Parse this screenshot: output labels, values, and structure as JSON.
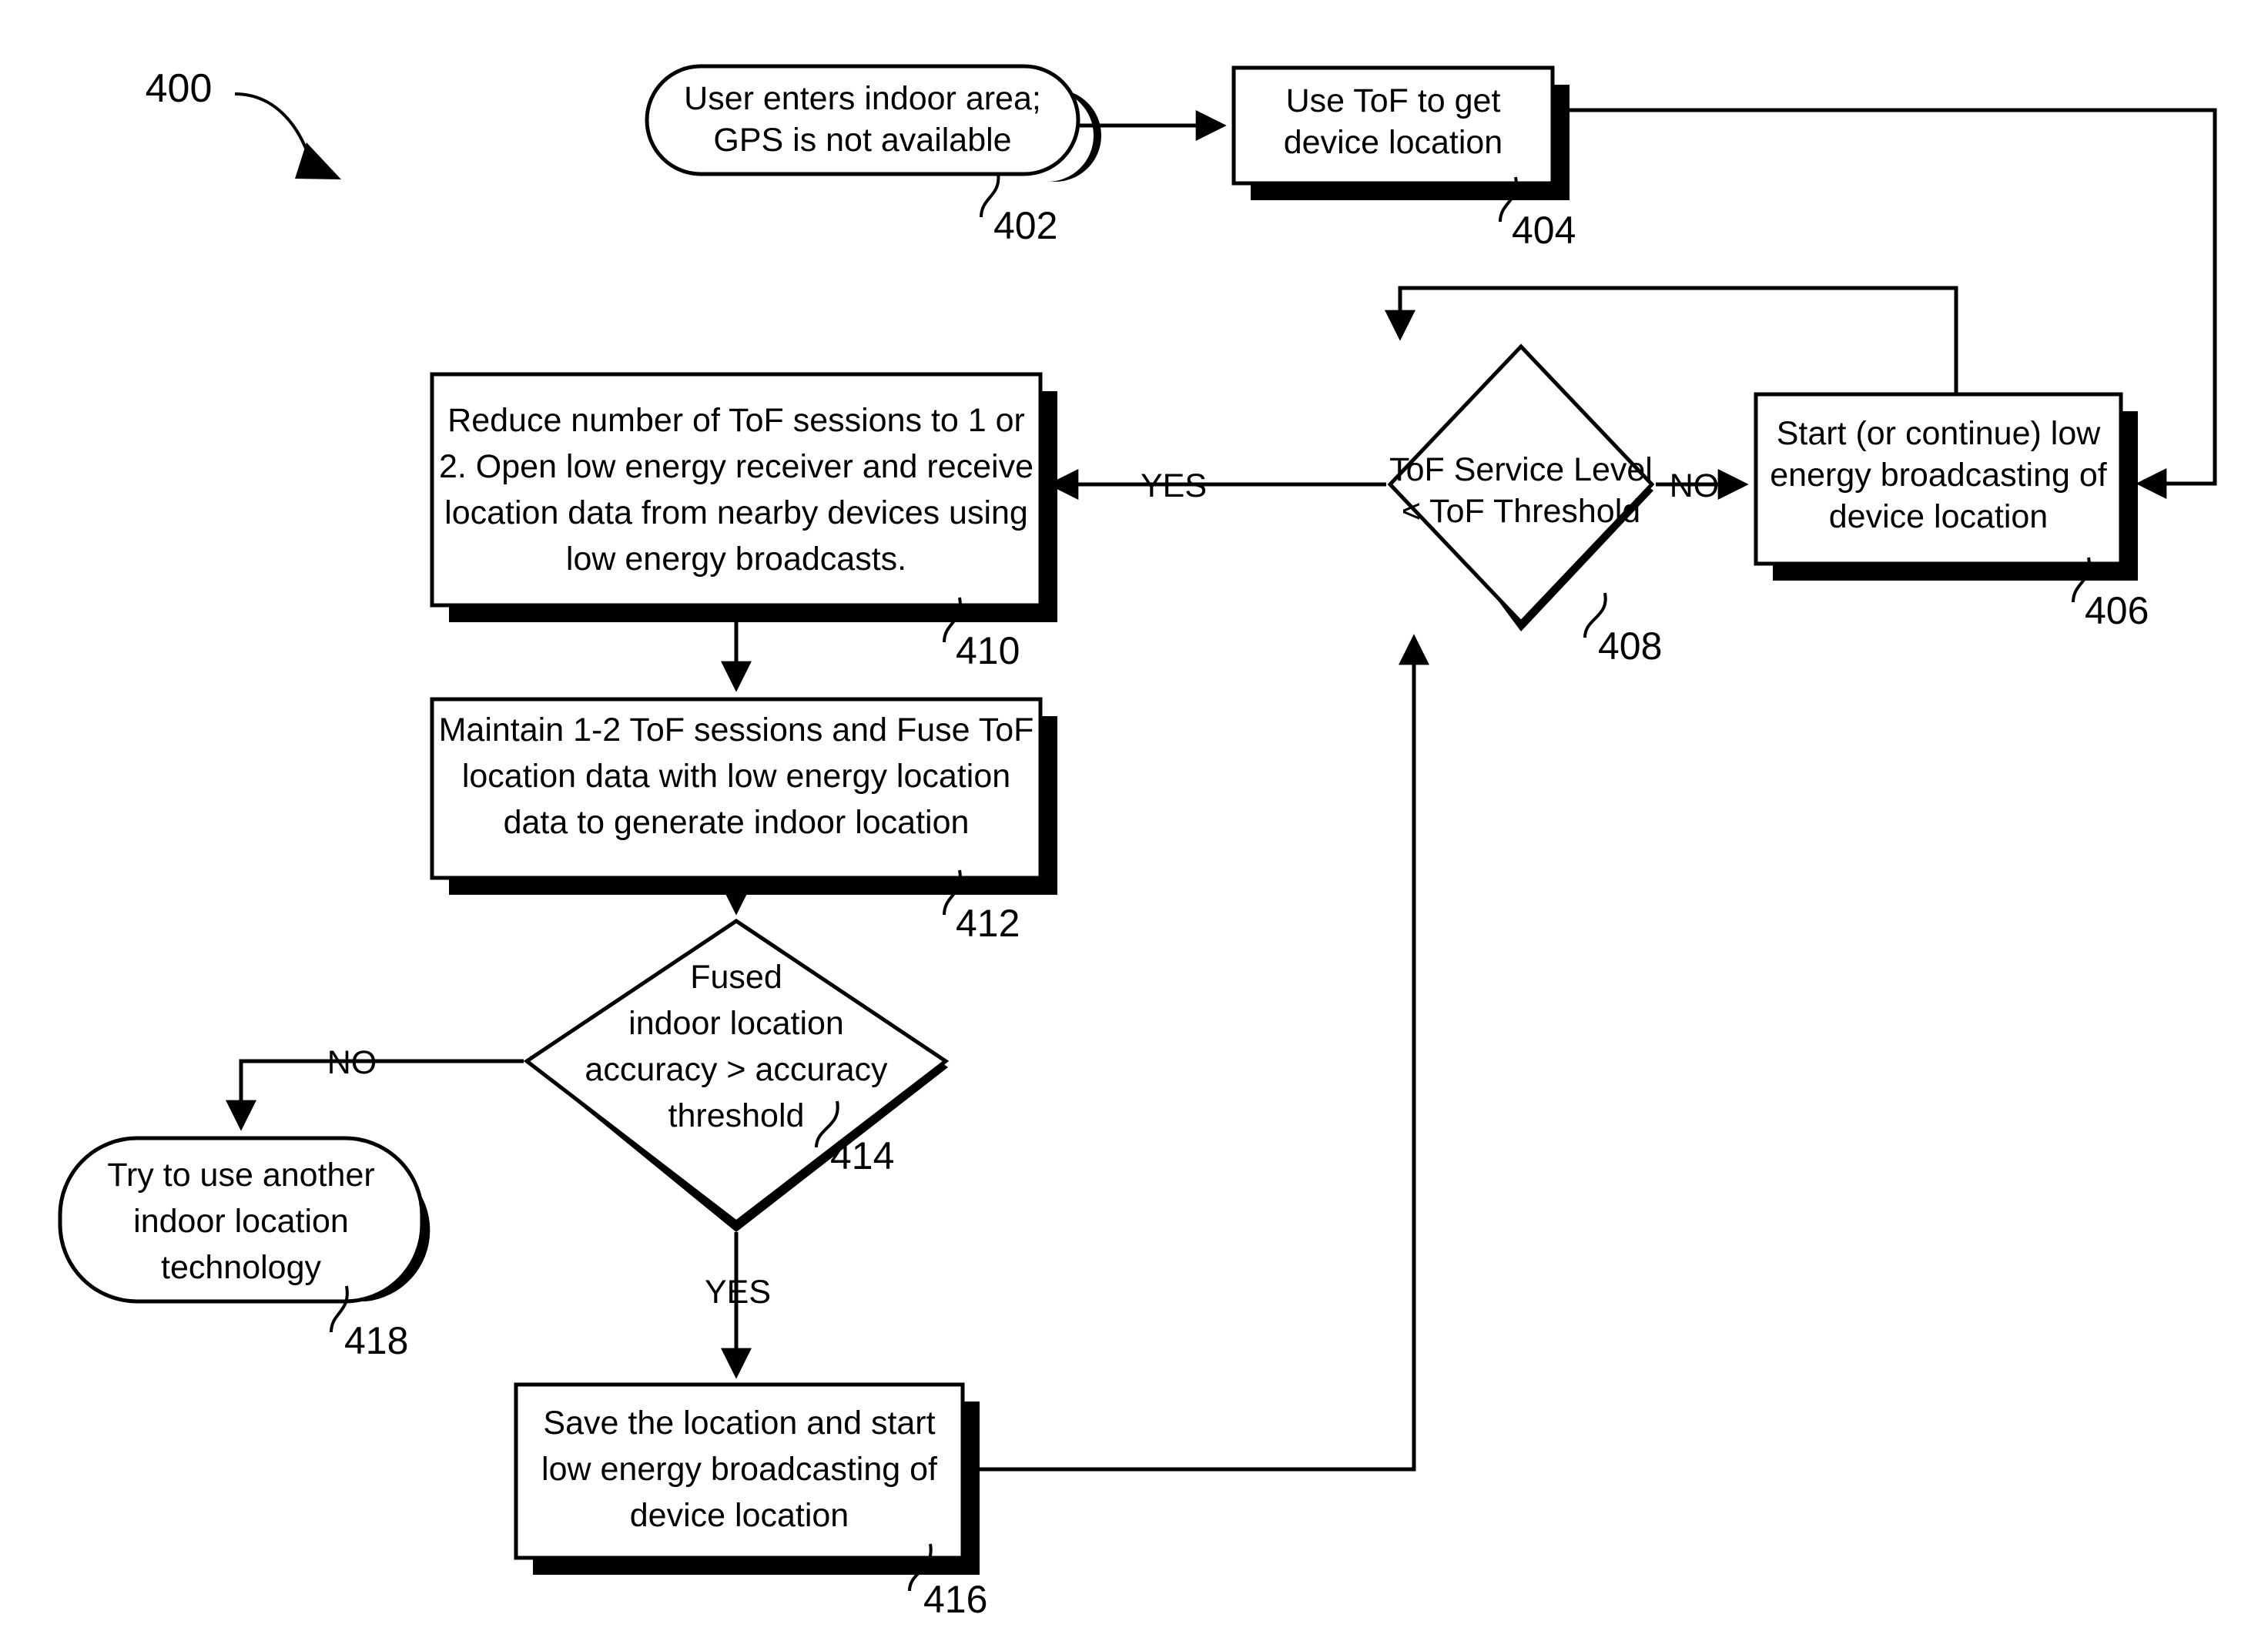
{
  "figure": {
    "number": "400",
    "type": "patent-flowchart"
  },
  "nodes": {
    "n402": {
      "ref": "402",
      "shape": "terminal",
      "lines": [
        "User enters indoor area;",
        "GPS is not available"
      ]
    },
    "n404": {
      "ref": "404",
      "shape": "process",
      "lines": [
        "Use ToF to get",
        "device location"
      ]
    },
    "n406": {
      "ref": "406",
      "shape": "process",
      "lines": [
        "Start (or continue) low",
        "energy broadcasting of",
        "device location"
      ]
    },
    "n408": {
      "ref": "408",
      "shape": "decision",
      "lines": [
        "ToF Service Level",
        "< ToF Threshold"
      ]
    },
    "n410": {
      "ref": "410",
      "shape": "process",
      "lines": [
        "Reduce number of ToF sessions to 1 or",
        "2.  Open low energy receiver and receive",
        "location data from nearby devices using",
        "low energy broadcasts."
      ]
    },
    "n412": {
      "ref": "412",
      "shape": "process",
      "lines": [
        "Maintain 1-2 ToF sessions and Fuse ToF",
        "location data with low energy location",
        "data to generate indoor location"
      ]
    },
    "n414": {
      "ref": "414",
      "shape": "decision",
      "lines": [
        "Fused",
        "indoor location",
        "accuracy > accuracy",
        "threshold"
      ]
    },
    "n416": {
      "ref": "416",
      "shape": "process",
      "lines": [
        "Save the location and start",
        "low energy broadcasting of",
        "device location"
      ]
    },
    "n418": {
      "ref": "418",
      "shape": "terminal",
      "lines": [
        "Try to use another",
        "indoor location",
        "technology"
      ]
    }
  },
  "edge_labels": {
    "yes_408": "YES",
    "no_408": "NO",
    "yes_414": "YES",
    "no_414": "NO"
  },
  "colors": {
    "stroke": "#000000",
    "fill": "#ffffff",
    "shadow": "#000000"
  }
}
